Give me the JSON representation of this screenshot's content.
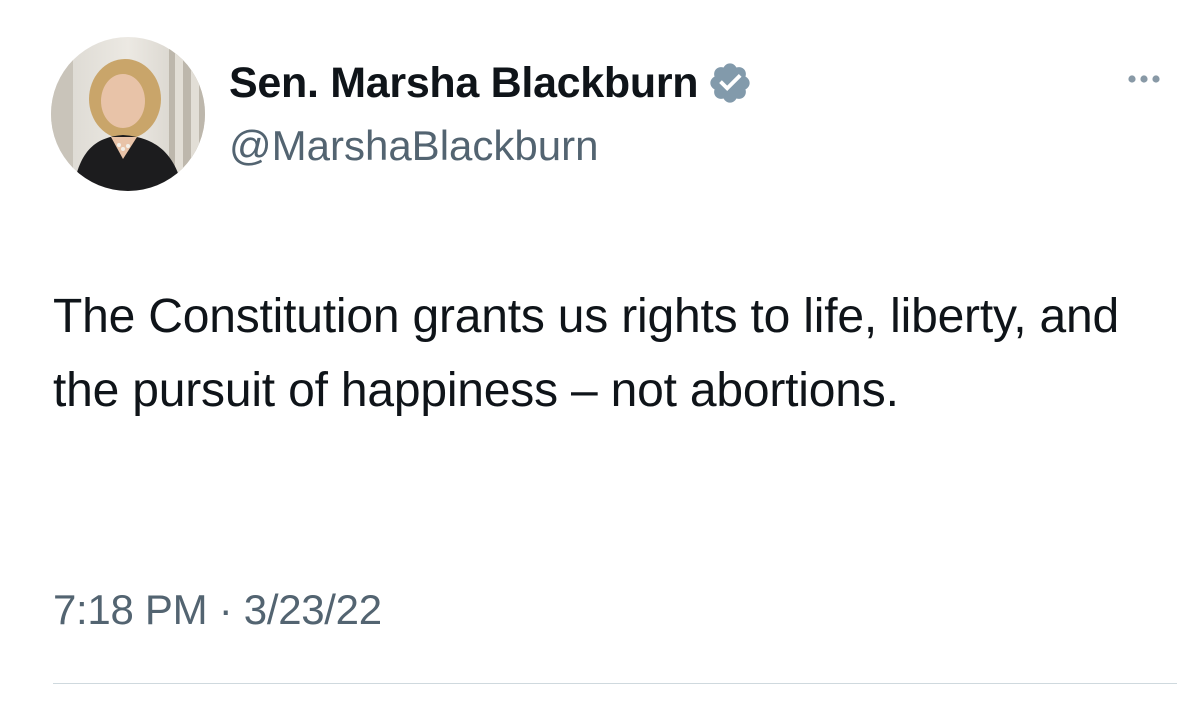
{
  "author": {
    "display_name": "Sen. Marsha Blackburn",
    "handle": "@MarshaBlackburn",
    "verified": true,
    "verified_badge_color": "#829aab"
  },
  "tweet": {
    "text": "The Constitution grants us rights to life, liberty, and the pursuit of happiness – not abortions.",
    "time": "7:18 PM",
    "separator": "·",
    "date": "3/23/22"
  },
  "icons": {
    "more": "more-horizontal-icon",
    "verified": "verified-badge-icon"
  },
  "colors": {
    "primary_text": "#0f1419",
    "secondary_text": "#536471",
    "divider": "#cfd9de"
  }
}
